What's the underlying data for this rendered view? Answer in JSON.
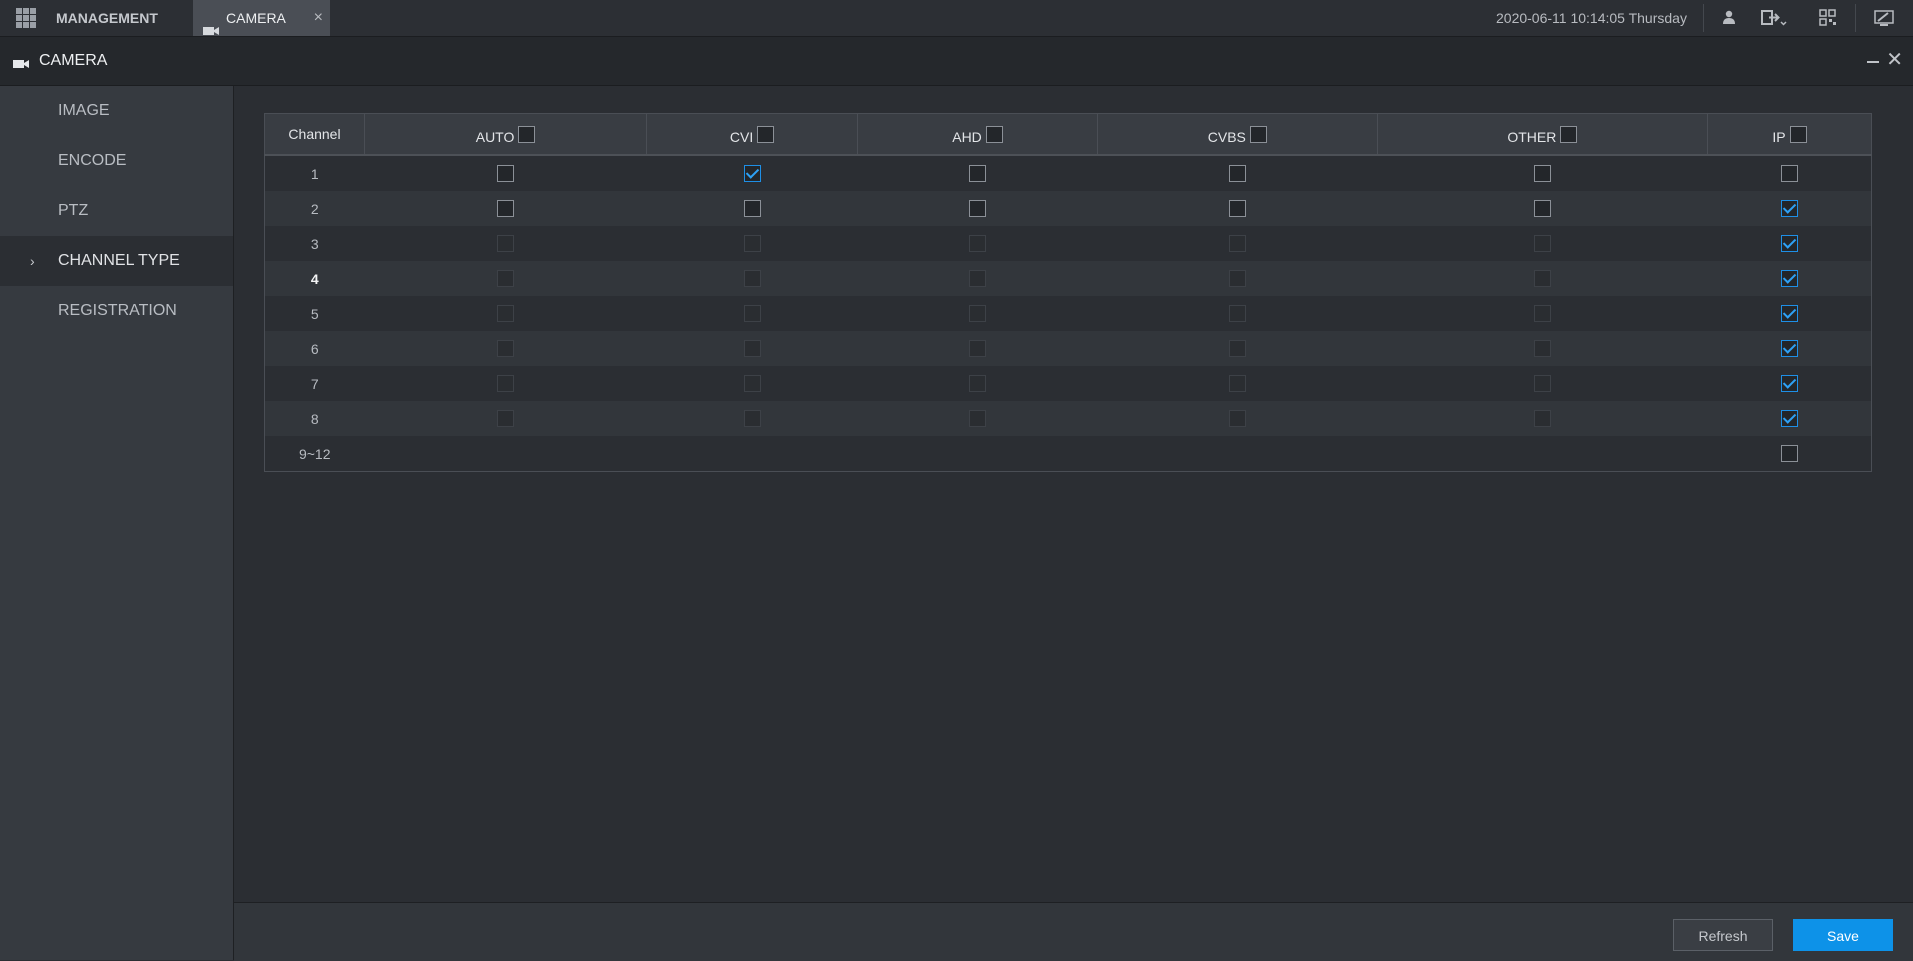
{
  "topbar": {
    "tabs": [
      {
        "label": "MANAGEMENT",
        "icon": "grid-menu-icon"
      },
      {
        "label": "CAMERA",
        "icon": "camera-icon",
        "close": "×"
      }
    ],
    "datetime": "2020-06-11 10:14:05 Thursday",
    "icons": [
      "user-icon",
      "logout-icon",
      "qr-code-icon",
      "display-icon"
    ]
  },
  "window": {
    "title": "CAMERA",
    "icon": "camera-icon",
    "close": "✕"
  },
  "sidebar": {
    "items": [
      {
        "label": "IMAGE",
        "active": false
      },
      {
        "label": "ENCODE",
        "active": false
      },
      {
        "label": "PTZ",
        "active": false
      },
      {
        "label": "CHANNEL TYPE",
        "active": true,
        "marker": "›"
      },
      {
        "label": "REGISTRATION",
        "active": false
      }
    ]
  },
  "table": {
    "channel_header": "Channel",
    "columns": [
      "AUTO",
      "CVI",
      "AHD",
      "CVBS",
      "OTHER",
      "IP"
    ],
    "rows": [
      {
        "channel": "1",
        "checked": [
          false,
          true,
          false,
          false,
          false,
          false
        ],
        "enabled": [
          true,
          true,
          true,
          true,
          true,
          true
        ]
      },
      {
        "channel": "2",
        "checked": [
          false,
          false,
          false,
          false,
          false,
          true
        ],
        "enabled": [
          true,
          true,
          true,
          true,
          true,
          true
        ]
      },
      {
        "channel": "3",
        "checked": [
          false,
          false,
          false,
          false,
          false,
          true
        ],
        "enabled": [
          false,
          false,
          false,
          false,
          false,
          true
        ]
      },
      {
        "channel": "4",
        "checked": [
          false,
          false,
          false,
          false,
          false,
          true
        ],
        "enabled": [
          false,
          false,
          false,
          false,
          false,
          true
        ]
      },
      {
        "channel": "5",
        "checked": [
          false,
          false,
          false,
          false,
          false,
          true
        ],
        "enabled": [
          false,
          false,
          false,
          false,
          false,
          true
        ]
      },
      {
        "channel": "6",
        "checked": [
          false,
          false,
          false,
          false,
          false,
          true
        ],
        "enabled": [
          false,
          false,
          false,
          false,
          false,
          true
        ]
      },
      {
        "channel": "7",
        "checked": [
          false,
          false,
          false,
          false,
          false,
          true
        ],
        "enabled": [
          false,
          false,
          false,
          false,
          false,
          true
        ]
      },
      {
        "channel": "8",
        "checked": [
          false,
          false,
          false,
          false,
          false,
          true
        ],
        "enabled": [
          false,
          false,
          false,
          false,
          false,
          true
        ]
      },
      {
        "channel": "9~12",
        "checked": [
          null,
          null,
          null,
          null,
          null,
          false
        ],
        "enabled": [
          false,
          false,
          false,
          false,
          false,
          true
        ]
      }
    ]
  },
  "footer": {
    "refresh_label": "Refresh",
    "save_label": "Save"
  },
  "colors": {
    "accent": "#0d92e8",
    "check": "#2ea1f5",
    "background": "#2b2e33",
    "sidebar": "#363a40"
  }
}
